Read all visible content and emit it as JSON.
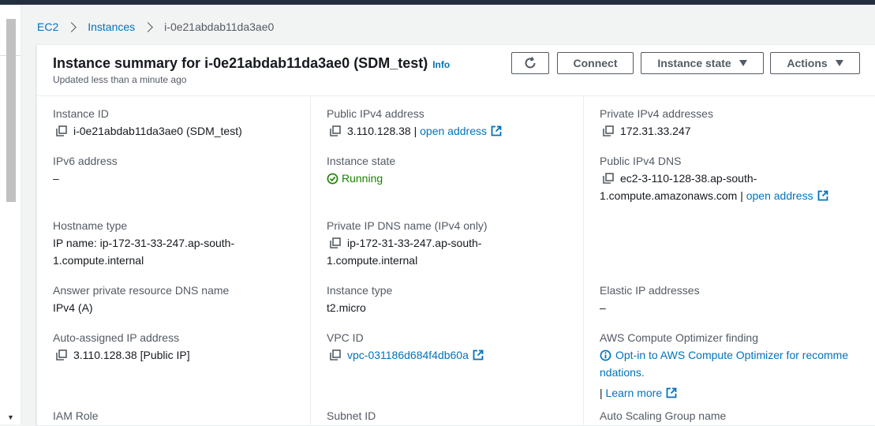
{
  "breadcrumb": {
    "root": "EC2",
    "section": "Instances",
    "current": "i-0e21abdab11da3ae0"
  },
  "header": {
    "title": "Instance summary for i-0e21abdab11da3ae0 (SDM_test)",
    "info": "Info",
    "updated": "Updated less than a minute ago",
    "refresh_icon": "refresh-icon",
    "connect": "Connect",
    "instance_state": "Instance state",
    "actions": "Actions"
  },
  "fields": {
    "instance_id": {
      "label": "Instance ID",
      "value": "i-0e21abdab11da3ae0 (SDM_test)"
    },
    "public_ipv4": {
      "label": "Public IPv4 address",
      "value": "3.110.128.38",
      "sep": "|",
      "link": "open address"
    },
    "private_ipv4": {
      "label": "Private IPv4 addresses",
      "value": "172.31.33.247"
    },
    "ipv6": {
      "label": "IPv6 address",
      "value": "–"
    },
    "instance_state": {
      "label": "Instance state",
      "value": "Running"
    },
    "public_dns": {
      "label": "Public IPv4 DNS",
      "line1": "ec2-3-110-128-38.ap-south-",
      "line2": "1.compute.amazonaws.com",
      "sep": "|",
      "link": "open address"
    },
    "hostname_type": {
      "label": "Hostname type",
      "line1": "IP name: ip-172-31-33-247.ap-south-",
      "line2": "1.compute.internal"
    },
    "private_dns": {
      "label": "Private IP DNS name (IPv4 only)",
      "line1": "ip-172-31-33-247.ap-south-",
      "line2": "1.compute.internal"
    },
    "answer_dns": {
      "label": "Answer private resource DNS name",
      "value": "IPv4 (A)"
    },
    "instance_type": {
      "label": "Instance type",
      "value": "t2.micro"
    },
    "elastic_ip": {
      "label": "Elastic IP addresses",
      "value": "–"
    },
    "auto_ip": {
      "label": "Auto-assigned IP address",
      "value": "3.110.128.38 [Public IP]"
    },
    "vpc_id": {
      "label": "VPC ID",
      "value": "vpc-031186d684f4db60a"
    },
    "optimizer": {
      "label": "AWS Compute Optimizer finding",
      "line1": "Opt-in to AWS Compute Optimizer for recomme",
      "line2": "ndations.",
      "sep": "|",
      "link": "Learn more"
    },
    "iam_role": {
      "label": "IAM Role"
    },
    "subnet_id": {
      "label": "Subnet ID"
    },
    "asg": {
      "label": "Auto Scaling Group name"
    }
  },
  "colors": {
    "link": "#0073bb",
    "running": "#1d8102",
    "topbar": "#232f3e"
  }
}
